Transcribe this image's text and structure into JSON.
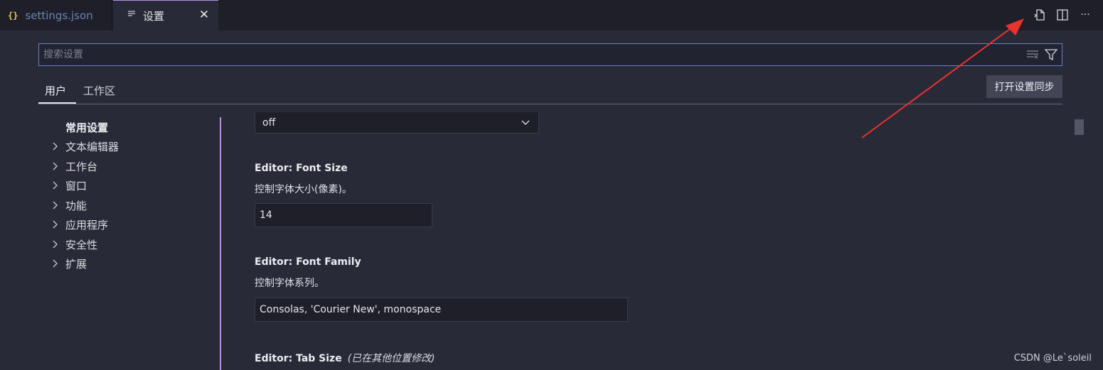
{
  "tabs": [
    {
      "label": "settings.json",
      "icon": "json-braces-icon"
    },
    {
      "label": "设置",
      "icon": "list-icon",
      "close": "✕"
    }
  ],
  "json_icon_glyph": "{}",
  "editor_actions": [
    "open-settings-json-icon",
    "split-editor-icon",
    "more-actions-icon"
  ],
  "more_glyph": "···",
  "search": {
    "placeholder": "搜索设置",
    "value": ""
  },
  "scopes": {
    "user": "用户",
    "workspace": "工作区"
  },
  "sync_button": "打开设置同步",
  "toc": {
    "common": "常用设置",
    "items": [
      "文本编辑器",
      "工作台",
      "窗口",
      "功能",
      "应用程序",
      "安全性",
      "扩展"
    ]
  },
  "settings": {
    "select_value": "off",
    "font_size": {
      "title": "Editor: Font Size",
      "desc": "控制字体大小(像素)。",
      "value": "14"
    },
    "font_family": {
      "title": "Editor: Font Family",
      "desc": "控制字体系列。",
      "value": "Consolas, 'Courier New', monospace"
    },
    "tab_size": {
      "title": "Editor: Tab Size",
      "note": "(已在其他位置修改)"
    }
  },
  "colors": {
    "accent": "#b98ee0",
    "arrow": "#e8332e",
    "search_border": "#6d7fc2"
  },
  "watermark": "CSDN @Le`soleil"
}
